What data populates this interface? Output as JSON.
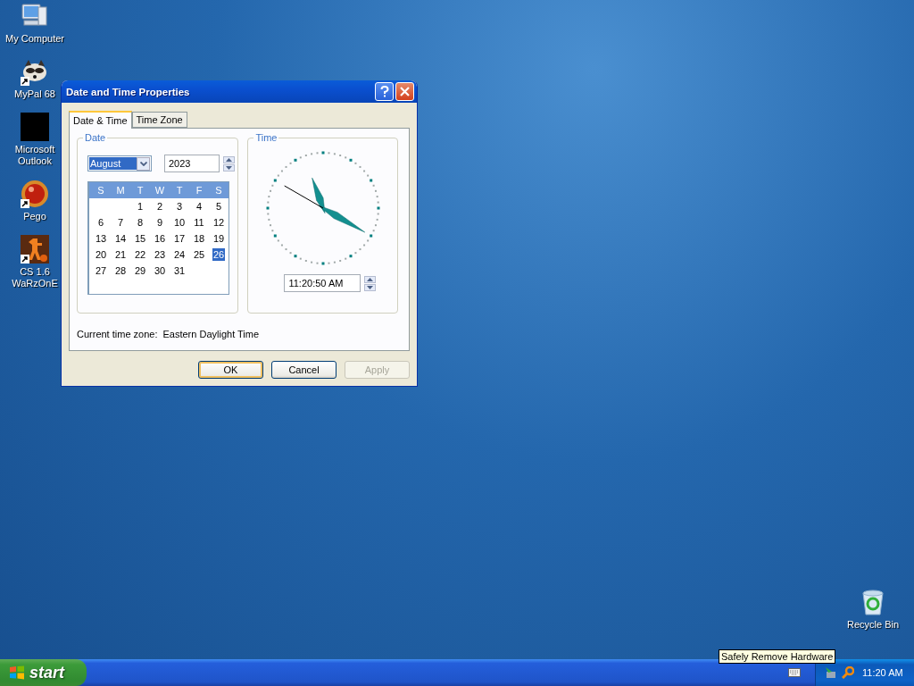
{
  "desktop_icons": [
    {
      "label": "My Computer",
      "kind": "computer",
      "shortcut": false
    },
    {
      "label": "MyPal 68",
      "kind": "raccoon",
      "shortcut": true
    },
    {
      "label": "Microsoft Outlook",
      "kind": "blank",
      "shortcut": false
    },
    {
      "label": "Pego",
      "kind": "ball",
      "shortcut": true
    },
    {
      "label": "CS 1.6 WaRzOnE",
      "kind": "soldier",
      "shortcut": true
    },
    {
      "label": "Recycle Bin",
      "kind": "recycle",
      "shortcut": false
    }
  ],
  "dialog": {
    "title": "Date and Time Properties",
    "tabs": [
      {
        "label": "Date & Time",
        "selected": true
      },
      {
        "label": "Time Zone",
        "selected": false
      }
    ],
    "date_group": {
      "label": "Date",
      "month": "August",
      "year": "2023",
      "weekdays": [
        "S",
        "M",
        "T",
        "W",
        "T",
        "F",
        "S"
      ],
      "weeks": [
        [
          {
            "label": "1",
            "selected": false
          },
          {
            "label": "2",
            "selected": false
          },
          {
            "label": "3",
            "selected": false
          },
          {
            "label": "4",
            "selected": false
          },
          {
            "label": "5",
            "selected": false
          }
        ],
        [
          {
            "label": "6",
            "selected": false
          },
          {
            "label": "7",
            "selected": false
          },
          {
            "label": "8",
            "selected": false
          },
          {
            "label": "9",
            "selected": false
          },
          {
            "label": "10",
            "selected": false
          },
          {
            "label": "11",
            "selected": false
          },
          {
            "label": "12",
            "selected": false
          }
        ],
        [
          {
            "label": "13",
            "selected": false
          },
          {
            "label": "14",
            "selected": false
          },
          {
            "label": "15",
            "selected": false
          },
          {
            "label": "16",
            "selected": false
          },
          {
            "label": "17",
            "selected": false
          },
          {
            "label": "18",
            "selected": false
          },
          {
            "label": "19",
            "selected": false
          }
        ],
        [
          {
            "label": "20",
            "selected": false
          },
          {
            "label": "21",
            "selected": false
          },
          {
            "label": "22",
            "selected": false
          },
          {
            "label": "23",
            "selected": false
          },
          {
            "label": "24",
            "selected": false
          },
          {
            "label": "25",
            "selected": false
          },
          {
            "label": "26",
            "selected": true
          }
        ],
        [
          {
            "label": "27",
            "selected": false
          },
          {
            "label": "28",
            "selected": false
          },
          {
            "label": "29",
            "selected": false
          },
          {
            "label": "30",
            "selected": false
          },
          {
            "label": "31",
            "selected": false
          }
        ]
      ]
    },
    "time_group": {
      "label": "Time",
      "time": "11:20:50 AM"
    },
    "timezone_label": "Current time zone:",
    "timezone": "Eastern Daylight Time",
    "buttons": [
      {
        "label": "OK",
        "kind": "default",
        "disabled": false
      },
      {
        "label": "Cancel",
        "kind": "normal",
        "disabled": false
      },
      {
        "label": "Apply",
        "kind": "normal",
        "disabled": true
      }
    ]
  },
  "taskbar": {
    "start": "start",
    "tooltip": "Safely Remove Hardware",
    "clock": "11:20 AM"
  }
}
